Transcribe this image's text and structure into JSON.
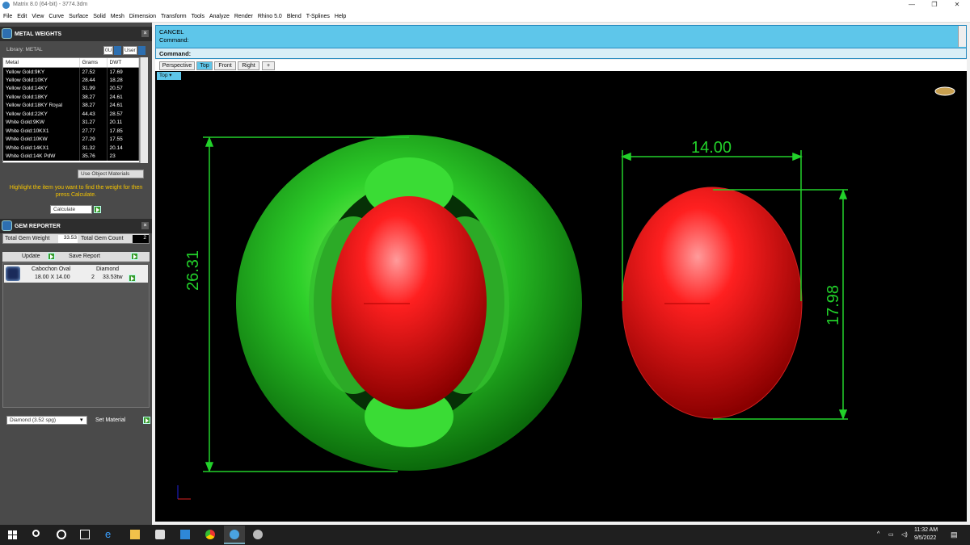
{
  "window": {
    "title": "Matrix 8.0 (64-bit) - 3774.3dm",
    "controls": [
      "—",
      "❐",
      "✕"
    ]
  },
  "menu": [
    "File",
    "Edit",
    "View",
    "Curve",
    "Surface",
    "Solid",
    "Mesh",
    "Dimension",
    "Transform",
    "Tools",
    "Analyze",
    "Render",
    "Rhino 5.0",
    "Blend",
    "T-Splines",
    "Help"
  ],
  "metal_weights": {
    "title": "METAL WEIGHTS",
    "library_label": "Library: METAL",
    "toggle_1": "0U",
    "toggle_2": "User",
    "columns": [
      "Metal",
      "Grams",
      "DWT"
    ],
    "rows": [
      [
        "Yellow Gold:9KY",
        "27.52",
        "17.69"
      ],
      [
        "Yellow Gold:10KY",
        "28.44",
        "18.28"
      ],
      [
        "Yellow Gold:14KY",
        "31.99",
        "20.57"
      ],
      [
        "Yellow Gold:18KY",
        "38.27",
        "24.61"
      ],
      [
        "Yellow Gold:18KY Royal",
        "38.27",
        "24.61"
      ],
      [
        "Yellow Gold:22KY",
        "44.43",
        "28.57"
      ],
      [
        "White Gold:9KW",
        "31.27",
        "20.11"
      ],
      [
        "White Gold:10KX1",
        "27.77",
        "17.85"
      ],
      [
        "White Gold:10KW",
        "27.29",
        "17.55"
      ],
      [
        "White Gold:14KX1",
        "31.32",
        "20.14"
      ],
      [
        "White Gold:14K PdW",
        "35.76",
        "23"
      ]
    ],
    "use_object_materials": "Use Object Materials",
    "hint": "Highlight the item you want to find the weight for then press Calculate.",
    "calculate": "Calculate"
  },
  "gem_reporter": {
    "title": "GEM REPORTER",
    "total_weight_label": "Total Gem Weight",
    "total_weight_value": "33.53",
    "total_count_label": "Total Gem Count",
    "total_count_value": "2",
    "update": "Update",
    "save_report": "Save Report",
    "gem": {
      "cut": "Cabochon Oval",
      "material": "Diamond",
      "size": "18.00 X 14.00",
      "count": "2",
      "weight": "33.53tw"
    },
    "material_select": "Diamond     (3.52 spg)",
    "set_material": "Set Material"
  },
  "command": {
    "line1": "CANCEL",
    "line2": "Command:",
    "prompt": "Command:"
  },
  "viewport_tabs": [
    "Perspective",
    "Top",
    "Front",
    "Right",
    "+"
  ],
  "active_tab": "Top",
  "view_label": "Top",
  "dimensions": {
    "height_ring": "26.31",
    "width_stone": "14.00",
    "height_stone": "17.98"
  },
  "colors": {
    "accent": "#5ec6ea",
    "dimension": "#22d12a",
    "stone": "#e01010",
    "ring": "#20c020"
  },
  "taskbar": {
    "time": "11:32 AM",
    "date": "9/5/2022"
  }
}
